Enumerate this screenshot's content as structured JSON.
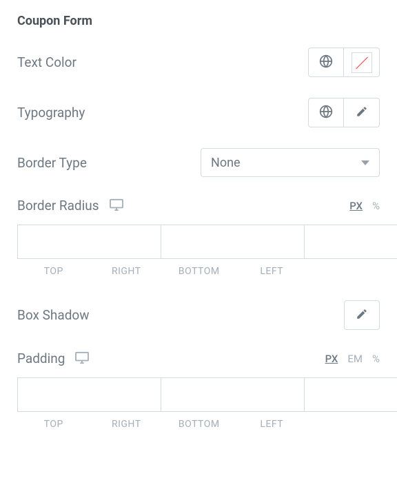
{
  "section": {
    "title": "Coupon Form"
  },
  "textColor": {
    "label": "Text Color"
  },
  "typography": {
    "label": "Typography"
  },
  "borderType": {
    "label": "Border Type",
    "value": "None"
  },
  "borderRadius": {
    "label": "Border Radius",
    "units": {
      "px": "PX",
      "pct": "%"
    },
    "sides": {
      "top": "TOP",
      "right": "RIGHT",
      "bottom": "BOTTOM",
      "left": "LEFT"
    }
  },
  "boxShadow": {
    "label": "Box Shadow"
  },
  "padding": {
    "label": "Padding",
    "units": {
      "px": "PX",
      "em": "EM",
      "pct": "%"
    },
    "sides": {
      "top": "TOP",
      "right": "RIGHT",
      "bottom": "BOTTOM",
      "left": "LEFT"
    }
  }
}
